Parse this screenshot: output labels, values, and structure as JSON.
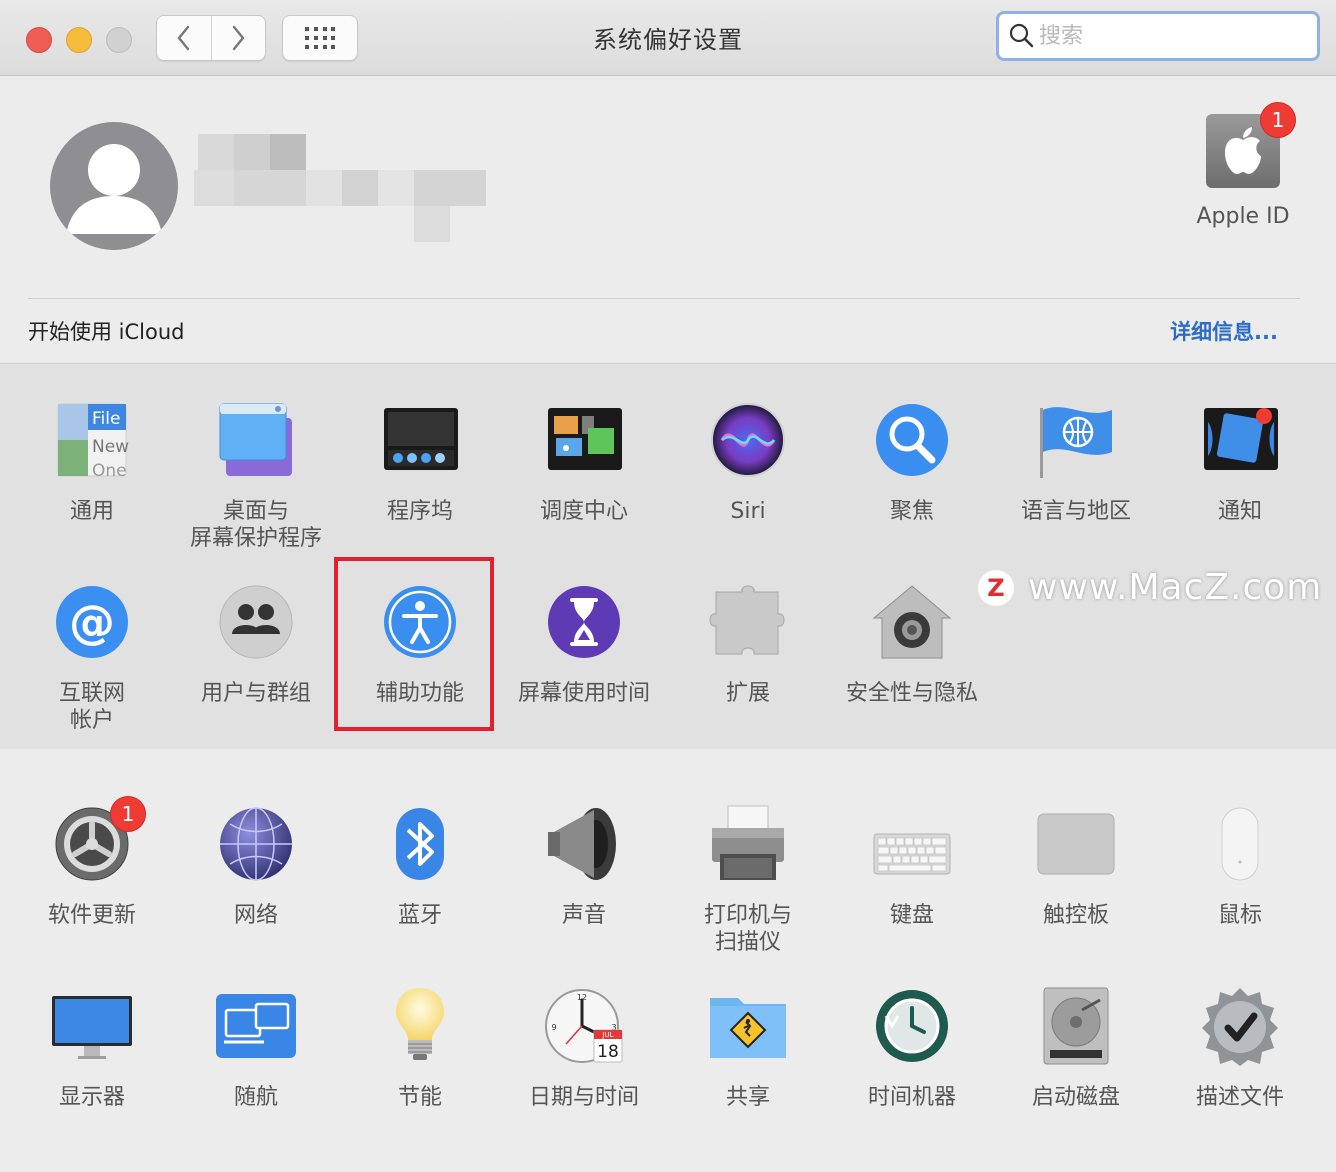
{
  "window": {
    "title": "系统偏好设置",
    "search_placeholder": "搜索"
  },
  "account": {
    "appleid_label": "Apple ID",
    "appleid_badge": "1",
    "icloud_text": "开始使用 iCloud",
    "details_link": "详细信息..."
  },
  "row1": [
    {
      "label": "通用",
      "icon": "general-icon"
    },
    {
      "label": "桌面与\n屏幕保护程序",
      "icon": "desktop-screensaver-icon"
    },
    {
      "label": "程序坞",
      "icon": "dock-icon"
    },
    {
      "label": "调度中心",
      "icon": "mission-control-icon"
    },
    {
      "label": "Siri",
      "icon": "siri-icon"
    },
    {
      "label": "聚焦",
      "icon": "spotlight-icon"
    },
    {
      "label": "语言与地区",
      "icon": "language-region-icon"
    },
    {
      "label": "通知",
      "icon": "notifications-icon"
    }
  ],
  "row2": [
    {
      "label": "互联网\n帐户",
      "icon": "internet-accounts-icon"
    },
    {
      "label": "用户与群组",
      "icon": "users-groups-icon"
    },
    {
      "label": "辅助功能",
      "icon": "accessibility-icon"
    },
    {
      "label": "屏幕使用时间",
      "icon": "screen-time-icon"
    },
    {
      "label": "扩展",
      "icon": "extensions-icon"
    },
    {
      "label": "安全性与隐私",
      "icon": "security-privacy-icon"
    }
  ],
  "row3": [
    {
      "label": "软件更新",
      "icon": "software-update-icon",
      "badge": "1"
    },
    {
      "label": "网络",
      "icon": "network-icon"
    },
    {
      "label": "蓝牙",
      "icon": "bluetooth-icon"
    },
    {
      "label": "声音",
      "icon": "sound-icon"
    },
    {
      "label": "打印机与\n扫描仪",
      "icon": "printers-scanners-icon"
    },
    {
      "label": "键盘",
      "icon": "keyboard-icon"
    },
    {
      "label": "触控板",
      "icon": "trackpad-icon"
    },
    {
      "label": "鼠标",
      "icon": "mouse-icon"
    }
  ],
  "row4": [
    {
      "label": "显示器",
      "icon": "displays-icon"
    },
    {
      "label": "随航",
      "icon": "sidecar-icon"
    },
    {
      "label": "节能",
      "icon": "energy-saver-icon"
    },
    {
      "label": "日期与时间",
      "icon": "date-time-icon"
    },
    {
      "label": "共享",
      "icon": "sharing-icon"
    },
    {
      "label": "时间机器",
      "icon": "time-machine-icon"
    },
    {
      "label": "启动磁盘",
      "icon": "startup-disk-icon"
    },
    {
      "label": "描述文件",
      "icon": "profiles-icon"
    }
  ],
  "date_icon": {
    "month": "JUL",
    "day": "18"
  },
  "general_icon": {
    "line1": "File",
    "line2": "New",
    "line3": "One"
  },
  "watermark": {
    "letter": "Z",
    "text": "www.MacZ.com"
  }
}
